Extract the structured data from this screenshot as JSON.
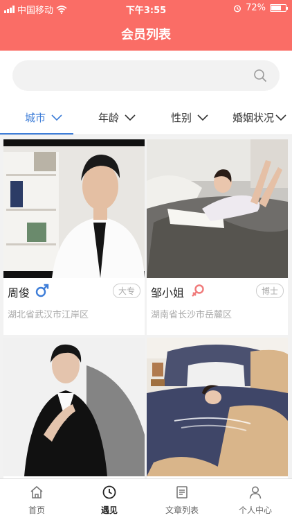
{
  "status_bar": {
    "carrier": "中国移动",
    "time": "下午3:55",
    "battery_percent": "72%",
    "battery_level": 0.72
  },
  "header": {
    "title": "会员列表"
  },
  "search": {
    "placeholder": "",
    "value": "",
    "icon": "search-icon"
  },
  "filters": [
    {
      "label": "城市",
      "active": true
    },
    {
      "label": "年龄",
      "active": false
    },
    {
      "label": "性别",
      "active": false
    },
    {
      "label": "婚姻状况",
      "active": false
    }
  ],
  "members": [
    {
      "name": "周俊",
      "gender": "male",
      "education": "大专",
      "location": "湖北省武汉市江岸区"
    },
    {
      "name": "邹小姐",
      "gender": "female",
      "education": "博士",
      "location": "湖南省长沙市岳麓区"
    },
    {
      "name": "",
      "gender": "",
      "education": "",
      "location": ""
    },
    {
      "name": "",
      "gender": "",
      "education": "",
      "location": ""
    }
  ],
  "tabbar": [
    {
      "label": "首页",
      "icon": "home-icon",
      "active": false
    },
    {
      "label": "遇见",
      "icon": "clock-icon",
      "active": true
    },
    {
      "label": "文章列表",
      "icon": "document-icon",
      "active": false
    },
    {
      "label": "个人中心",
      "icon": "person-icon",
      "active": false
    }
  ],
  "colors": {
    "brand": "#fa6d66",
    "accent": "#3d7dd8",
    "male": "#3d7dd8",
    "female": "#f07a7a"
  }
}
